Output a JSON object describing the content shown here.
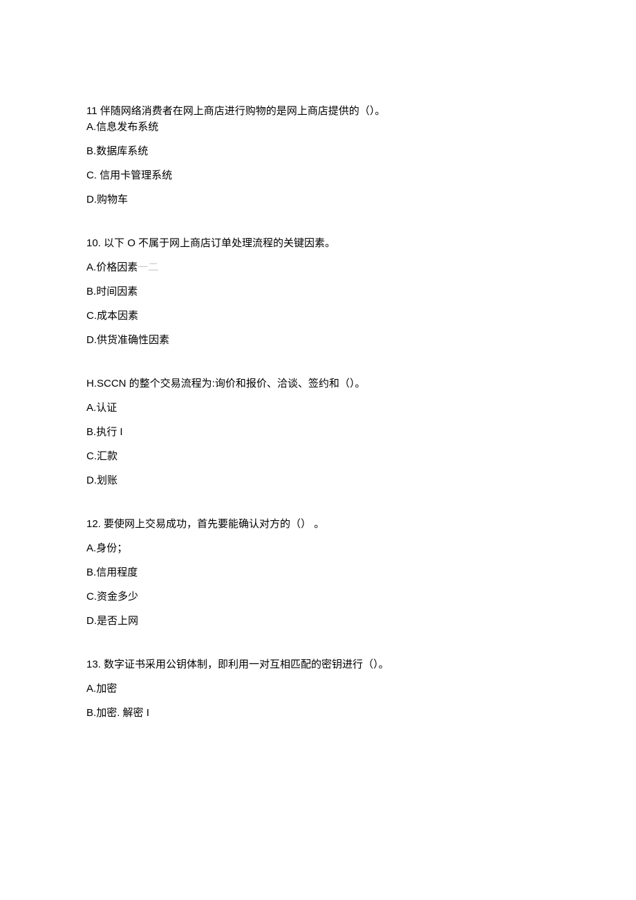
{
  "questions": [
    {
      "number": "11",
      "text": "伴随网络消费者在网上商店进行购物的是网上商店提供的（）。",
      "options": [
        {
          "key": "A",
          "text": "信息发布系统"
        },
        {
          "key": "B",
          "text": "数据库系统"
        },
        {
          "key": "C",
          "text": " 信用卡管理系统"
        },
        {
          "key": "D",
          "text": "购物车"
        }
      ]
    },
    {
      "number": "10.",
      "text": "以下 O 不属于网上商店订单处理流程的关键因素。",
      "options": [
        {
          "key": "A",
          "text": "价格因素",
          "faint": "一二"
        },
        {
          "key": "B",
          "text": "时间因素"
        },
        {
          "key": "C",
          "text": "成本因素"
        },
        {
          "key": "D",
          "text": "供货准确性因素"
        }
      ]
    },
    {
      "number": "H.",
      "text": "SCCN 的整个交易流程为:询价和报价、洽谈、签约和（）。",
      "options": [
        {
          "key": "A",
          "text": "认证"
        },
        {
          "key": "B",
          "text": "执行 I"
        },
        {
          "key": "C",
          "text": "汇款"
        },
        {
          "key": "D",
          "text": "划账"
        }
      ]
    },
    {
      "number": "12.",
      "text": "要使网上交易成功，首先要能确认对方的（） 。",
      "options": [
        {
          "key": "A",
          "text": "身份；"
        },
        {
          "key": "B",
          "text": "信用程度"
        },
        {
          "key": "C",
          "text": "资金多少"
        },
        {
          "key": "D",
          "text": "是否上网"
        }
      ]
    },
    {
      "number": "13.",
      "text": "数字证书采用公钥体制，即利用一对互相匹配的密钥进行（）。",
      "options": [
        {
          "key": "A",
          "text": "加密"
        },
        {
          "key": "B",
          "text": "加密. 解密 I"
        }
      ]
    }
  ]
}
